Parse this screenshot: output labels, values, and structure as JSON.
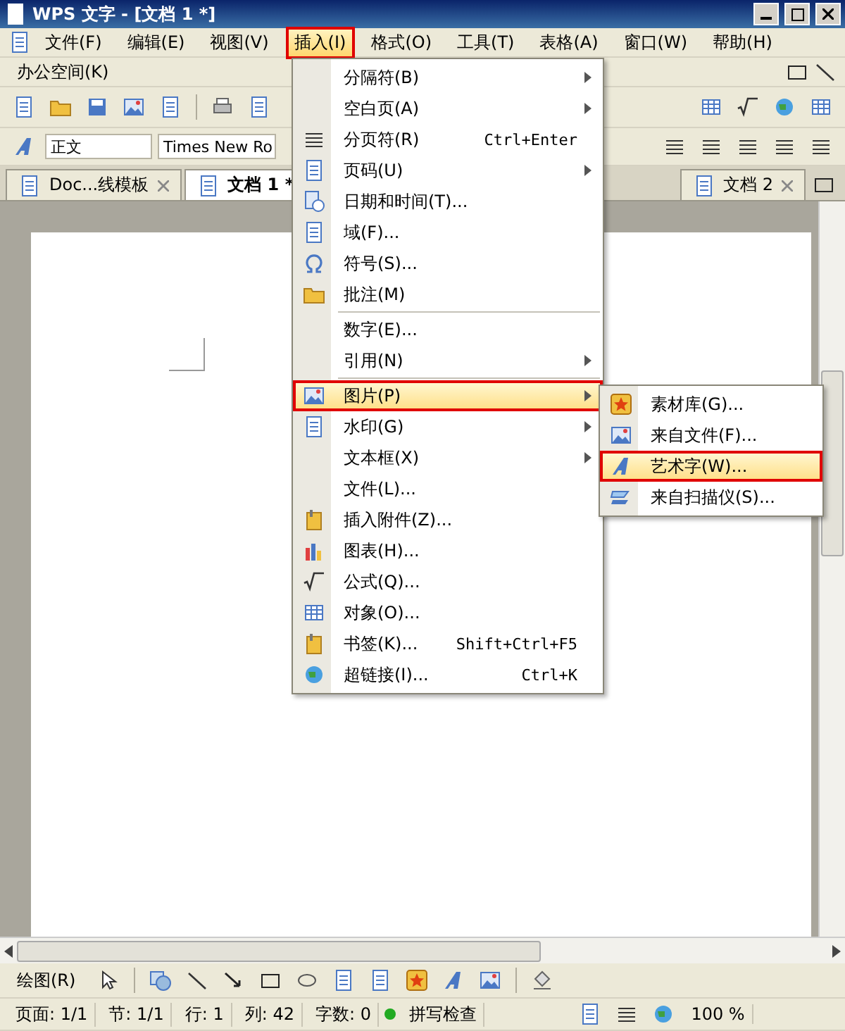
{
  "window": {
    "title": "WPS 文字 - [文档 1 *]"
  },
  "menubar": [
    {
      "label": "文件(F)",
      "selected": false
    },
    {
      "label": "编辑(E)",
      "selected": false
    },
    {
      "label": "视图(V)",
      "selected": false
    },
    {
      "label": "插入(I)",
      "selected": true
    },
    {
      "label": "格式(O)",
      "selected": false
    },
    {
      "label": "工具(T)",
      "selected": false
    },
    {
      "label": "表格(A)",
      "selected": false
    },
    {
      "label": "窗口(W)",
      "selected": false
    },
    {
      "label": "帮助(H)",
      "selected": false
    }
  ],
  "menubar_row2": {
    "label": "办公空间(K)"
  },
  "format_toolbar": {
    "style": "正文",
    "font": "Times New Ro"
  },
  "tabs": [
    {
      "label": "Doc...线模板",
      "selected": false
    },
    {
      "label": "文档 1 *",
      "selected": true
    },
    {
      "label": "文档 2",
      "selected": false
    }
  ],
  "insert_menu": [
    {
      "label": "分隔符(B)",
      "submenu": true,
      "selected": false,
      "separator_before": false
    },
    {
      "label": "空白页(A)",
      "submenu": true,
      "selected": false,
      "separator_before": false
    },
    {
      "label": "分页符(R)",
      "shortcut": "Ctrl+Enter",
      "submenu": false,
      "selected": false,
      "separator_before": false
    },
    {
      "label": "页码(U)",
      "submenu": true,
      "selected": false,
      "separator_before": false
    },
    {
      "label": "日期和时间(T)...",
      "submenu": false,
      "selected": false,
      "separator_before": false
    },
    {
      "label": "域(F)...",
      "submenu": false,
      "selected": false,
      "separator_before": false
    },
    {
      "label": "符号(S)...",
      "submenu": false,
      "selected": false,
      "separator_before": false
    },
    {
      "label": "批注(M)",
      "submenu": false,
      "selected": false,
      "separator_before": false
    },
    {
      "label": "数字(E)...",
      "submenu": false,
      "selected": false,
      "separator_before": true
    },
    {
      "label": "引用(N)",
      "submenu": true,
      "selected": false,
      "separator_before": false
    },
    {
      "label": "图片(P)",
      "submenu": true,
      "selected": true,
      "separator_before": true
    },
    {
      "label": "水印(G)",
      "submenu": true,
      "selected": false,
      "separator_before": false
    },
    {
      "label": "文本框(X)",
      "submenu": true,
      "selected": false,
      "separator_before": false
    },
    {
      "label": "文件(L)...",
      "submenu": false,
      "selected": false,
      "separator_before": false
    },
    {
      "label": "插入附件(Z)...",
      "submenu": false,
      "selected": false,
      "separator_before": false
    },
    {
      "label": "图表(H)...",
      "submenu": false,
      "selected": false,
      "separator_before": false
    },
    {
      "label": "公式(Q)...",
      "submenu": false,
      "selected": false,
      "separator_before": false
    },
    {
      "label": "对象(O)...",
      "submenu": false,
      "selected": false,
      "separator_before": false
    },
    {
      "label": "书签(K)...",
      "shortcut": "Shift+Ctrl+F5",
      "submenu": false,
      "selected": false,
      "separator_before": false
    },
    {
      "label": "超链接(I)...",
      "shortcut": "Ctrl+K",
      "submenu": false,
      "selected": false,
      "separator_before": false
    }
  ],
  "picture_submenu": [
    {
      "label": "素材库(G)...",
      "selected": false
    },
    {
      "label": "来自文件(F)...",
      "selected": false
    },
    {
      "label": "艺术字(W)...",
      "selected": true
    },
    {
      "label": "来自扫描仪(S)...",
      "selected": false
    }
  ],
  "drawing_toolbar": {
    "label": "绘图(R)"
  },
  "status_bar": {
    "fields": [
      "页面: 1/1",
      "节: 1/1",
      "行: 1",
      "列: 42",
      "字数: 0"
    ],
    "spell_check": {
      "label": "拼写检查",
      "color": "#22aa22"
    },
    "zoom": "100 %"
  }
}
